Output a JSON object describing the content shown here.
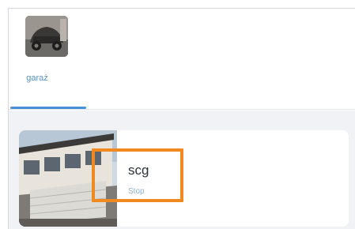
{
  "tabs": [
    {
      "label": "garaż",
      "icon": "garage-icon",
      "selected": true
    }
  ],
  "devices": [
    {
      "name": "scg",
      "status": "Stop",
      "image": "house-garage-image"
    }
  ],
  "colors": {
    "accent": "#4a90d9",
    "highlight": "#f0891f",
    "background": "#f1f2f5"
  }
}
